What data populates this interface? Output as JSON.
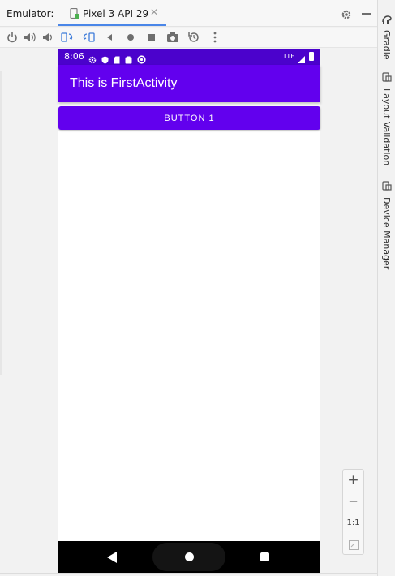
{
  "window": {
    "emulator_label": "Emulator:",
    "device_tab": "Pixel 3 API 29",
    "close_glyph": "✕"
  },
  "toolbar": {
    "buttons": [
      "power-icon",
      "volume-up-icon",
      "volume-down-icon",
      "rotate-left-icon",
      "rotate-right-icon",
      "back-icon",
      "home-icon",
      "overview-icon",
      "screenshot-icon",
      "snapshot-icon",
      "more-icon"
    ]
  },
  "side_tabs": {
    "gradle": "Gradle",
    "layout_validation": "Layout Validation",
    "device_manager": "Device Manager"
  },
  "phone": {
    "status": {
      "time": "8:06",
      "network": "LTE"
    },
    "app_title": "This is FirstActivity",
    "button_label": "BUTTON 1"
  },
  "zoom": {
    "zoom_in": "+",
    "zoom_out": "−",
    "actual_size": "1:1"
  },
  "colors": {
    "status_bar": "#4b02cc",
    "primary": "#6200ee",
    "tab_underline": "#4a86e8"
  }
}
